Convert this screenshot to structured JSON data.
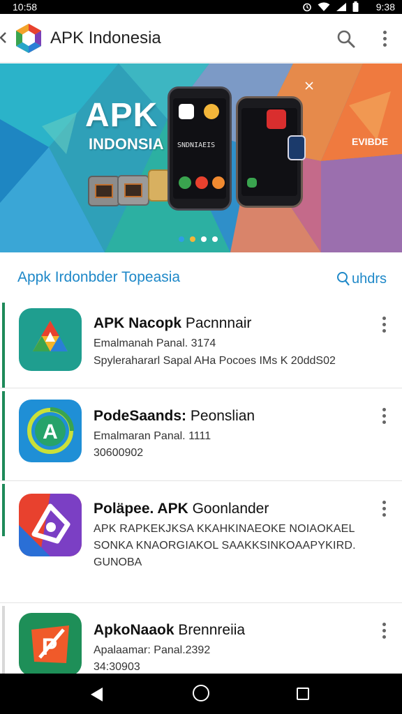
{
  "status_bar": {
    "time_left": "10:58",
    "time_right": "9:38",
    "icons": [
      "alarm-icon",
      "wifi-icon",
      "signal-icon",
      "battery-icon"
    ]
  },
  "app_bar": {
    "title": "APK Indonesia",
    "icons": [
      "back-chevron-icon",
      "logo-icon",
      "search-icon",
      "more-vert-icon"
    ]
  },
  "banner": {
    "title": "APK",
    "subtitle": "INDONSIA",
    "tag": "EVIBDE",
    "phone_1_text": "SNDNIAEIS",
    "dots": [
      "#2e9ee6",
      "#f4b63a",
      "#ffffff",
      "#ffffff"
    ]
  },
  "section": {
    "title": "Appk Irdonbder Topeasia",
    "search_label": "uhdrs"
  },
  "apps": [
    {
      "title_bold": "APK Nacopk",
      "title_rest": " Pacnnnair",
      "line1": "Emalmanah Panal. 3174",
      "line2": "Spylerahararl Sapal AHa Pocoes IMs K 20ddS02",
      "line3": "",
      "icon": "drive-triangle-icon",
      "icon_bg": "#1f9e8f"
    },
    {
      "title_bold": "PodeSaands:",
      "title_rest": " Peonslian",
      "line1": "Emalmaran Panal. 1111",
      "line2": "30600902",
      "line3": "",
      "icon": "letter-a-circle-icon",
      "icon_bg": "#1f8fd6"
    },
    {
      "title_bold": "Poläpee. APK",
      "title_rest": " Goonlander",
      "line1": "APK RAPKEKJKSA KKAHKINAEOKE NOIAOKAEL",
      "line2": "SONKA KNAORGIAKOL SAAKKSINKOAAPYKIRD.",
      "line3": "GUNOBA",
      "icon": "shield-logo-icon",
      "icon_bg": "#e8412e"
    },
    {
      "title_bold": "ApkoNaaok",
      "title_rest": " Brennreiia",
      "line1": "Apalaamar: Panal.2392",
      "line2": "34:30903",
      "line3": "",
      "icon": "flash-p-icon",
      "icon_bg": "#1e8f58"
    }
  ],
  "nav_bar": {
    "icons": [
      "nav-back-icon",
      "nav-home-icon",
      "nav-recents-icon"
    ]
  }
}
